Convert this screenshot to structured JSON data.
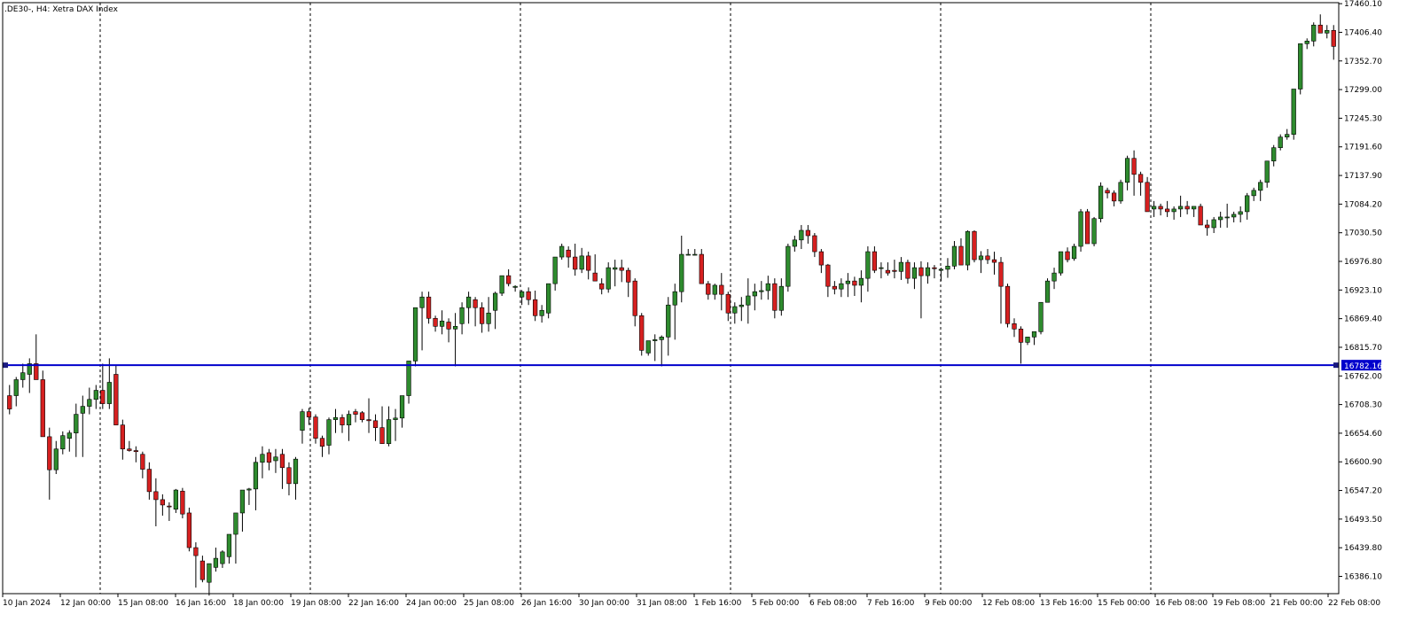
{
  "header": {
    "title": ".DE30-, H4:  Xetra DAX Index"
  },
  "chart_data": {
    "type": "candlestick",
    "title": ".DE30-, H4:  Xetra DAX Index",
    "symbol": ".DE30-",
    "timeframe": "H4",
    "instrument": "Xetra DAX Index",
    "y_ticks": [
      "17460.10",
      "17406.40",
      "17352.70",
      "17299.00",
      "17245.30",
      "17191.60",
      "17137.90",
      "17084.20",
      "17030.50",
      "16976.80",
      "16923.10",
      "16869.40",
      "16815.70",
      "16762.00",
      "16708.30",
      "16654.60",
      "16600.90",
      "16547.20",
      "16493.50",
      "16439.80",
      "16386.10"
    ],
    "x_ticks": [
      "10 Jan 2024",
      "12 Jan 00:00",
      "15 Jan 08:00",
      "16 Jan 16:00",
      "18 Jan 00:00",
      "19 Jan 08:00",
      "22 Jan 16:00",
      "24 Jan 00:00",
      "25 Jan 08:00",
      "26 Jan 16:00",
      "30 Jan 00:00",
      "31 Jan 08:00",
      "1 Feb 16:00",
      "5 Feb 00:00",
      "6 Feb 08:00",
      "7 Feb 16:00",
      "9 Feb 00:00",
      "12 Feb 08:00",
      "13 Feb 16:00",
      "15 Feb 00:00",
      "16 Feb 08:00",
      "19 Feb 08:00",
      "21 Feb 00:00",
      "22 Feb 08:00"
    ],
    "ylim": [
      16353.7,
      17462.0
    ],
    "horizontal_line": {
      "value": 16782.16,
      "label": "16782.16",
      "color": "#0000cc"
    },
    "colors": {
      "bull": "#2e8b2e",
      "bear": "#d62020",
      "wick": "#000000",
      "grid_separator": "#000000",
      "background": "#ffffff"
    },
    "candles": [
      [
        16725,
        16745,
        16690,
        16700
      ],
      [
        16725,
        16760,
        16705,
        16755
      ],
      [
        16755,
        16785,
        16740,
        16768
      ],
      [
        16765,
        16795,
        16730,
        16785
      ],
      [
        16785,
        16840,
        16755,
        16755
      ],
      [
        16755,
        16772,
        16648,
        16648
      ],
      [
        16648,
        16665,
        16530,
        16586
      ],
      [
        16586,
        16640,
        16578,
        16625
      ],
      [
        16625,
        16658,
        16615,
        16650
      ],
      [
        16645,
        16660,
        16620,
        16655
      ],
      [
        16655,
        16710,
        16610,
        16690
      ],
      [
        16692,
        16725,
        16610,
        16705
      ],
      [
        16705,
        16740,
        16690,
        16718
      ],
      [
        16718,
        16745,
        16700,
        16735
      ],
      [
        16735,
        16785,
        16700,
        16710
      ],
      [
        16710,
        16795,
        16700,
        16750
      ],
      [
        16765,
        16782,
        16700,
        16670
      ],
      [
        16670,
        16680,
        16605,
        16625
      ],
      [
        16625,
        16640,
        16620,
        16622
      ],
      [
        16622,
        16630,
        16600,
        16620
      ],
      [
        16615,
        16620,
        16570,
        16587
      ],
      [
        16587,
        16600,
        16530,
        16545
      ],
      [
        16545,
        16570,
        16480,
        16530
      ],
      [
        16530,
        16540,
        16500,
        16520
      ],
      [
        16518,
        16525,
        16490,
        16517
      ],
      [
        16512,
        16550,
        16505,
        16548
      ],
      [
        16546,
        16552,
        16495,
        16503
      ],
      [
        16505,
        16515,
        16433,
        16440
      ],
      [
        16440,
        16450,
        16365,
        16425
      ],
      [
        16415,
        16425,
        16375,
        16380
      ],
      [
        16375,
        16410,
        16350,
        16410
      ],
      [
        16403,
        16440,
        16395,
        16420
      ],
      [
        16410,
        16435,
        16402,
        16432
      ],
      [
        16423,
        16465,
        16410,
        16465
      ],
      [
        16465,
        16505,
        16410,
        16505
      ],
      [
        16505,
        16530,
        16470,
        16548
      ],
      [
        16548,
        16552,
        16520,
        16550
      ],
      [
        16550,
        16610,
        16510,
        16600
      ],
      [
        16600,
        16630,
        16570,
        16615
      ],
      [
        16618,
        16625,
        16585,
        16600
      ],
      [
        16603,
        16625,
        16580,
        16610
      ],
      [
        16615,
        16625,
        16550,
        16590
      ],
      [
        16590,
        16600,
        16538,
        16560
      ],
      [
        16560,
        16610,
        16530,
        16606
      ],
      [
        16660,
        16700,
        16635,
        16695
      ],
      [
        16695,
        16702,
        16670,
        16685
      ],
      [
        16685,
        16690,
        16635,
        16645
      ],
      [
        16645,
        16650,
        16610,
        16630
      ],
      [
        16632,
        16684,
        16615,
        16680
      ],
      [
        16680,
        16700,
        16655,
        16684
      ],
      [
        16684,
        16690,
        16655,
        16670
      ],
      [
        16670,
        16697,
        16640,
        16690
      ],
      [
        16695,
        16700,
        16675,
        16690
      ],
      [
        16693,
        16696,
        16675,
        16680
      ],
      [
        16680,
        16720,
        16655,
        16678
      ],
      [
        16678,
        16690,
        16640,
        16665
      ],
      [
        16665,
        16705,
        16635,
        16635
      ],
      [
        16635,
        16705,
        16630,
        16680
      ],
      [
        16680,
        16700,
        16640,
        16683
      ],
      [
        16683,
        16725,
        16665,
        16725
      ],
      [
        16725,
        16790,
        16710,
        16790
      ],
      [
        16790,
        16890,
        16780,
        16890
      ],
      [
        16890,
        16920,
        16810,
        16910
      ],
      [
        16910,
        16920,
        16860,
        16870
      ],
      [
        16870,
        16875,
        16845,
        16855
      ],
      [
        16855,
        16885,
        16840,
        16865
      ],
      [
        16863,
        16870,
        16825,
        16850
      ],
      [
        16850,
        16880,
        16780,
        16855
      ],
      [
        16860,
        16900,
        16840,
        16890
      ],
      [
        16890,
        16920,
        16860,
        16910
      ],
      [
        16905,
        16910,
        16855,
        16890
      ],
      [
        16890,
        16900,
        16843,
        16860
      ],
      [
        16860,
        16910,
        16845,
        16880
      ],
      [
        16885,
        16920,
        16850,
        16917
      ],
      [
        16917,
        16950,
        16912,
        16950
      ],
      [
        16950,
        16962,
        16930,
        16935
      ],
      [
        16928,
        16932,
        16920,
        16930
      ],
      [
        16910,
        16923,
        16895,
        16920
      ],
      [
        16920,
        16928,
        16895,
        16905
      ],
      [
        16905,
        16922,
        16865,
        16875
      ],
      [
        16875,
        16895,
        16862,
        16885
      ],
      [
        16880,
        16935,
        16870,
        16935
      ],
      [
        16935,
        16985,
        16922,
        16985
      ],
      [
        16985,
        17010,
        16980,
        17005
      ],
      [
        16998,
        17005,
        16965,
        16985
      ],
      [
        16985,
        17010,
        16950,
        16962
      ],
      [
        16962,
        17002,
        16955,
        16987
      ],
      [
        16987,
        16995,
        16943,
        16960
      ],
      [
        16955,
        16990,
        16945,
        16940
      ],
      [
        16935,
        16945,
        16915,
        16925
      ],
      [
        16925,
        16975,
        16918,
        16965
      ],
      [
        16962,
        16980,
        16930,
        16965
      ],
      [
        16965,
        16980,
        16938,
        16960
      ],
      [
        16960,
        16965,
        16910,
        16938
      ],
      [
        16940,
        16945,
        16855,
        16875
      ],
      [
        16875,
        16880,
        16800,
        16810
      ],
      [
        16805,
        16828,
        16800,
        16828
      ],
      [
        16828,
        16840,
        16790,
        16830
      ],
      [
        16830,
        16838,
        16780,
        16835
      ],
      [
        16835,
        16910,
        16800,
        16895
      ],
      [
        16895,
        16935,
        16830,
        16920
      ],
      [
        16920,
        17025,
        16900,
        16990
      ],
      [
        16990,
        17000,
        16988,
        16990
      ],
      [
        16990,
        17000,
        16988,
        16990
      ],
      [
        16990,
        17000,
        16955,
        16935
      ],
      [
        16935,
        16940,
        16905,
        16915
      ],
      [
        16915,
        16935,
        16905,
        16932
      ],
      [
        16932,
        16955,
        16885,
        16915
      ],
      [
        16915,
        16920,
        16865,
        16880
      ],
      [
        16880,
        16900,
        16860,
        16892
      ],
      [
        16892,
        16910,
        16865,
        16895
      ],
      [
        16895,
        16945,
        16860,
        16912
      ],
      [
        16912,
        16935,
        16885,
        16920
      ],
      [
        16920,
        16940,
        16905,
        16922
      ],
      [
        16922,
        16950,
        16905,
        16935
      ],
      [
        16935,
        16945,
        16870,
        16885
      ],
      [
        16885,
        16945,
        16875,
        16930
      ],
      [
        16930,
        17010,
        16920,
        17005
      ],
      [
        17005,
        17025,
        16995,
        17017
      ],
      [
        17017,
        17045,
        17000,
        17035
      ],
      [
        17035,
        17045,
        17010,
        17025
      ],
      [
        17025,
        17030,
        16985,
        16995
      ],
      [
        16995,
        17000,
        16955,
        16970
      ],
      [
        16970,
        16972,
        16910,
        16930
      ],
      [
        16930,
        16940,
        16915,
        16925
      ],
      [
        16925,
        16945,
        16910,
        16935
      ],
      [
        16935,
        16955,
        16910,
        16940
      ],
      [
        16940,
        16948,
        16912,
        16932
      ],
      [
        16932,
        16960,
        16900,
        16945
      ],
      [
        16945,
        17005,
        16920,
        16995
      ],
      [
        16995,
        17005,
        16955,
        16960
      ],
      [
        16965,
        16975,
        16945,
        16965
      ],
      [
        16960,
        16975,
        16950,
        16955
      ],
      [
        16960,
        16980,
        16945,
        16958
      ],
      [
        16958,
        16985,
        16942,
        16975
      ],
      [
        16975,
        16980,
        16935,
        16945
      ],
      [
        16945,
        16975,
        16925,
        16965
      ],
      [
        16965,
        16977,
        16870,
        16950
      ],
      [
        16950,
        16975,
        16935,
        16965
      ],
      [
        16965,
        16970,
        16945,
        16963
      ],
      [
        16960,
        16965,
        16940,
        16962
      ],
      [
        16962,
        16983,
        16946,
        16968
      ],
      [
        16968,
        17015,
        16962,
        17005
      ],
      [
        17005,
        17020,
        16973,
        16970
      ],
      [
        16970,
        17035,
        16960,
        17033
      ],
      [
        17033,
        17035,
        16975,
        16980
      ],
      [
        16980,
        16996,
        16955,
        16987
      ],
      [
        16987,
        17000,
        16972,
        16980
      ],
      [
        16980,
        16995,
        16952,
        16975
      ],
      [
        16975,
        16985,
        16860,
        16930
      ],
      [
        16930,
        16935,
        16853,
        16860
      ],
      [
        16860,
        16870,
        16835,
        16850
      ],
      [
        16850,
        16855,
        16785,
        16825
      ],
      [
        16825,
        16835,
        16820,
        16835
      ],
      [
        16835,
        16845,
        16820,
        16845
      ],
      [
        16845,
        16900,
        16840,
        16900
      ],
      [
        16900,
        16945,
        16900,
        16940
      ],
      [
        16940,
        16965,
        16925,
        16955
      ],
      [
        16955,
        16990,
        16950,
        16995
      ],
      [
        16995,
        17003,
        16975,
        16980
      ],
      [
        16982,
        17010,
        16978,
        17005
      ],
      [
        17005,
        17075,
        16995,
        17070
      ],
      [
        17070,
        17075,
        17015,
        17010
      ],
      [
        17010,
        17060,
        17005,
        17057
      ],
      [
        17057,
        17125,
        17050,
        17118
      ],
      [
        17110,
        17115,
        17095,
        17105
      ],
      [
        17105,
        17110,
        17080,
        17090
      ],
      [
        17090,
        17130,
        17085,
        17125
      ],
      [
        17125,
        17175,
        17110,
        17170
      ],
      [
        17170,
        17185,
        17100,
        17140
      ],
      [
        17140,
        17145,
        17100,
        17125
      ],
      [
        17125,
        17135,
        17080,
        17070
      ],
      [
        17075,
        17090,
        17060,
        17080
      ],
      [
        17080,
        17085,
        17063,
        17075
      ],
      [
        17075,
        17090,
        17060,
        17070
      ],
      [
        17070,
        17080,
        17055,
        17075
      ],
      [
        17075,
        17100,
        17060,
        17080
      ],
      [
        17080,
        17090,
        17065,
        17075
      ],
      [
        17075,
        17080,
        17060,
        17080
      ],
      [
        17080,
        17085,
        17045,
        17045
      ],
      [
        17045,
        17055,
        17025,
        17040
      ],
      [
        17040,
        17060,
        17030,
        17055
      ],
      [
        17055,
        17070,
        17040,
        17060
      ],
      [
        17060,
        17085,
        17040,
        17060
      ],
      [
        17060,
        17070,
        17050,
        17065
      ],
      [
        17065,
        17080,
        17050,
        17070
      ],
      [
        17070,
        17105,
        17055,
        17100
      ],
      [
        17100,
        17115,
        17090,
        17110
      ],
      [
        17110,
        17130,
        17090,
        17125
      ],
      [
        17125,
        17165,
        17115,
        17165
      ],
      [
        17165,
        17195,
        17155,
        17190
      ],
      [
        17190,
        17215,
        17185,
        17210
      ],
      [
        17210,
        17225,
        17205,
        17215
      ],
      [
        17215,
        17300,
        17205,
        17300
      ],
      [
        17300,
        17385,
        17290,
        17385
      ],
      [
        17385,
        17395,
        17375,
        17390
      ],
      [
        17390,
        17425,
        17380,
        17420
      ],
      [
        17420,
        17440,
        17405,
        17405
      ],
      [
        17405,
        17420,
        17395,
        17410
      ],
      [
        17410,
        17420,
        17355,
        17380
      ]
    ]
  }
}
